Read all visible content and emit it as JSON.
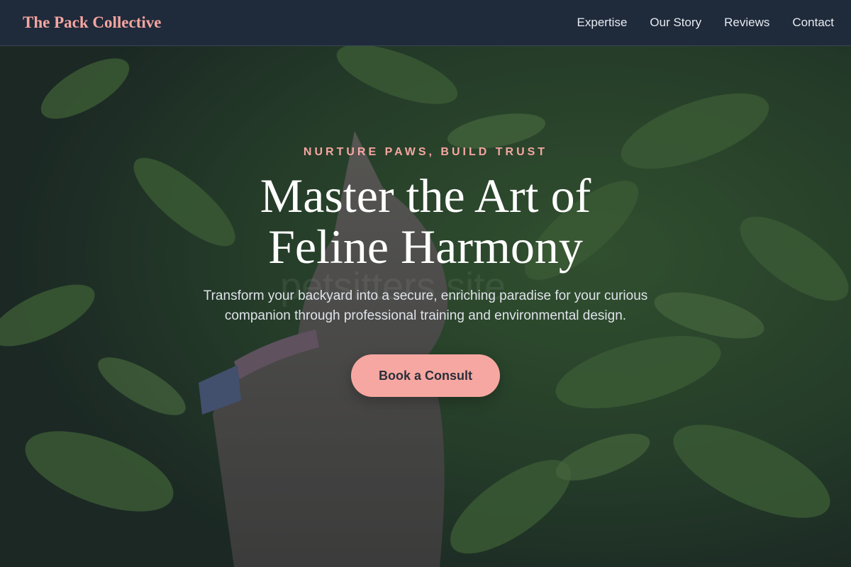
{
  "header": {
    "brand": "The Pack Collective",
    "nav": [
      "Expertise",
      "Our Story",
      "Reviews",
      "Contact"
    ]
  },
  "hero": {
    "eyebrow": "NURTURE PAWS, BUILD TRUST",
    "title": "Master the Art of Feline Harmony",
    "subtitle": "Transform your backyard into a secure, enriching paradise for your curious companion through professional training and environmental design.",
    "cta": "Book a Consult",
    "watermark": "petsitters site"
  },
  "colors": {
    "accent": "#f7a7a1",
    "header_bg": "#1f2a3b",
    "foliage": "#3f6a2e"
  }
}
